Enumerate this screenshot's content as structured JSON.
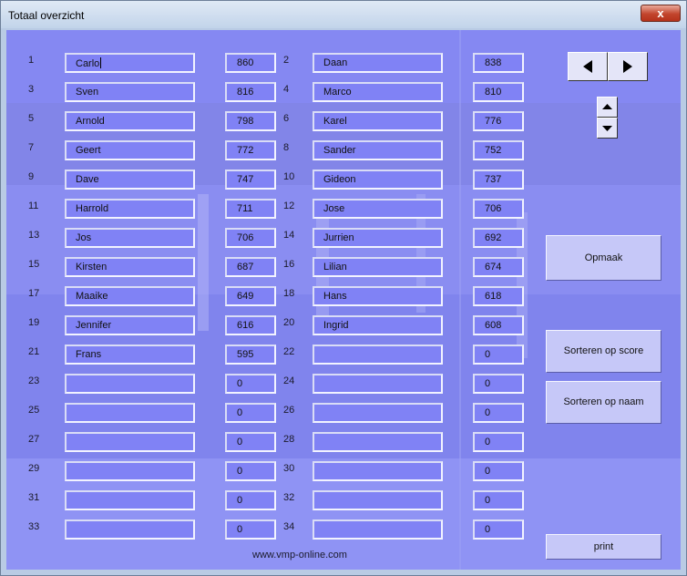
{
  "window": {
    "title": "Totaal overzicht",
    "close_glyph": "x"
  },
  "players": [
    {
      "num": "1",
      "name": "Carlo",
      "score": "860"
    },
    {
      "num": "2",
      "name": "Daan",
      "score": "838"
    },
    {
      "num": "3",
      "name": "Sven",
      "score": "816"
    },
    {
      "num": "4",
      "name": "Marco",
      "score": "810"
    },
    {
      "num": "5",
      "name": "Arnold",
      "score": "798"
    },
    {
      "num": "6",
      "name": "Karel",
      "score": "776"
    },
    {
      "num": "7",
      "name": "Geert",
      "score": "772"
    },
    {
      "num": "8",
      "name": "Sander",
      "score": "752"
    },
    {
      "num": "9",
      "name": "Dave",
      "score": "747"
    },
    {
      "num": "10",
      "name": "Gideon",
      "score": "737"
    },
    {
      "num": "11",
      "name": "Harrold",
      "score": "711"
    },
    {
      "num": "12",
      "name": "Jose",
      "score": "706"
    },
    {
      "num": "13",
      "name": "Jos",
      "score": "706"
    },
    {
      "num": "14",
      "name": "Jurrien",
      "score": "692"
    },
    {
      "num": "15",
      "name": "Kirsten",
      "score": "687"
    },
    {
      "num": "16",
      "name": "Lilian",
      "score": "674"
    },
    {
      "num": "17",
      "name": "Maaike",
      "score": "649"
    },
    {
      "num": "18",
      "name": "Hans",
      "score": "618"
    },
    {
      "num": "19",
      "name": "Jennifer",
      "score": "616"
    },
    {
      "num": "20",
      "name": "Ingrid",
      "score": "608"
    },
    {
      "num": "21",
      "name": "Frans",
      "score": "595"
    },
    {
      "num": "22",
      "name": "",
      "score": "0"
    },
    {
      "num": "23",
      "name": "",
      "score": "0"
    },
    {
      "num": "24",
      "name": "",
      "score": "0"
    },
    {
      "num": "25",
      "name": "",
      "score": "0"
    },
    {
      "num": "26",
      "name": "",
      "score": "0"
    },
    {
      "num": "27",
      "name": "",
      "score": "0"
    },
    {
      "num": "28",
      "name": "",
      "score": "0"
    },
    {
      "num": "29",
      "name": "",
      "score": "0"
    },
    {
      "num": "30",
      "name": "",
      "score": "0"
    },
    {
      "num": "31",
      "name": "",
      "score": "0"
    },
    {
      "num": "32",
      "name": "",
      "score": "0"
    },
    {
      "num": "33",
      "name": "",
      "score": "0"
    },
    {
      "num": "34",
      "name": "",
      "score": "0"
    }
  ],
  "buttons": {
    "opmaak": "Opmaak",
    "sort_score": "Sorteren op score",
    "sort_name": "Sorteren op naam",
    "print": "print"
  },
  "icons": {
    "prev": "triangle-left-icon",
    "next": "triangle-right-icon",
    "up": "triangle-up-icon",
    "down": "triangle-down-icon"
  },
  "footer": "www.vmp-online.com",
  "colors": {
    "panel": "#8486f2",
    "field": "#8082f5",
    "button": "#c6c8f8"
  }
}
